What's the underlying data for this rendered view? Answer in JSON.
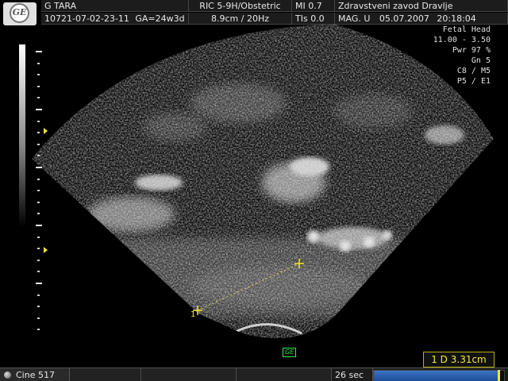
{
  "header": {
    "patient_name": "G TARA",
    "patient_id": "10721-07-02-23-11",
    "ga": "GA=24w3d",
    "probe": "RIC 5-9H/Obstetric",
    "depth_freq": "8.9cm / 20Hz",
    "mi": "MI  0.7",
    "tis": "TIs  0.0",
    "institution": "Zdravstveni zavod Dravlje",
    "mode": "MAG. U",
    "date": "05.07.2007",
    "time": "20:18:04"
  },
  "params": {
    "preset": "Fetal Head",
    "freq": "11.00 - 3.50",
    "pwr": "Pwr  97 %",
    "gn": "Gn   5",
    "c_m": "C8 / M5",
    "p_e": "P5 / E1"
  },
  "measurement": {
    "readout": "1  D 3.31cm",
    "caliper_label": "1",
    "logo_tag": "GE"
  },
  "bottom": {
    "cine": "Cine 517",
    "seconds": "26 sec",
    "progress_fraction": 0.96
  },
  "colors": {
    "caliper": "#f2e52e",
    "progress": "#2a60b0",
    "ge_tag": "#36e84a"
  },
  "logo": "GE monogram"
}
